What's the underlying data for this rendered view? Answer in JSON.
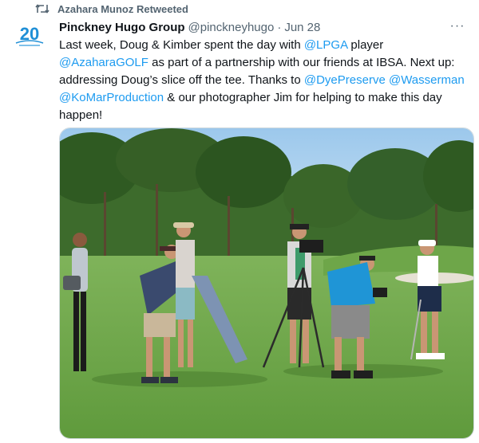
{
  "retweet": {
    "label": "Azahara Munoz Retweeted",
    "icon": "retweet-icon"
  },
  "author": {
    "avatar_icon": "anniversary-20-logo",
    "avatar_logo_number": "20",
    "name": "Pinckney Hugo Group",
    "handle": "@pinckneyhugo",
    "separator": "·",
    "date": "Jun 28",
    "more_icon": "more-icon",
    "more_label": "···"
  },
  "tweet": {
    "t1": "Last week, Doug & Kimber spent the day with ",
    "m1": "@LPGA",
    "t2": " player ",
    "m2": "@AzaharaGOLF",
    "t3": " as part of a partnership with our friends at IBSA. Next up: addressing Doug’s slice off the tee. Thanks to ",
    "m3": "@DyePreserve",
    "t4": " ",
    "m4": "@Wasserman",
    "t5": " ",
    "m5": "@KoMarProduction",
    "t6": " & our photographer Jim for helping to make this day happen!"
  },
  "colors": {
    "link": "#1d9bf0",
    "secondary_text": "#536471",
    "primary_text": "#0f1419",
    "logo_blue": "#1f8fd6"
  }
}
